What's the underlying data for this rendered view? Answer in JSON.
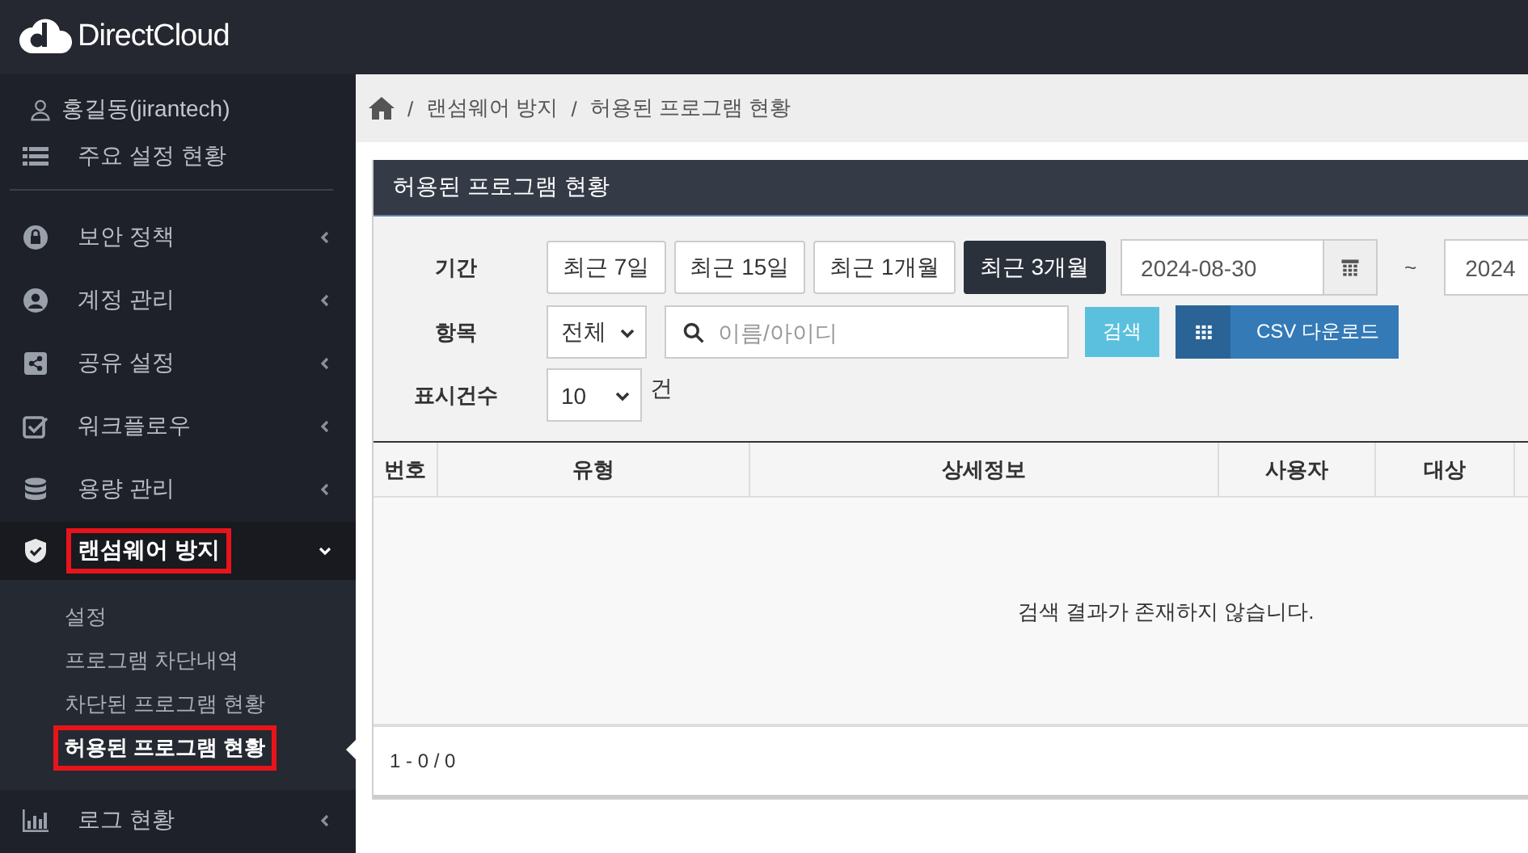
{
  "brand": "DirectCloud",
  "sidebar": {
    "user": "홍길동(jirantech)",
    "items": [
      {
        "label": "주요 설정 현황",
        "kind": "link"
      },
      {
        "label": "보안 정책",
        "kind": "menu",
        "expanded": false,
        "highlighted": false
      },
      {
        "label": "계정 관리",
        "kind": "menu",
        "expanded": false,
        "highlighted": false
      },
      {
        "label": "공유 설정",
        "kind": "menu",
        "expanded": false,
        "highlighted": false
      },
      {
        "label": "워크플로우",
        "kind": "menu",
        "expanded": false,
        "highlighted": false
      },
      {
        "label": "용량 관리",
        "kind": "menu",
        "expanded": false,
        "highlighted": false
      },
      {
        "label": "랜섬웨어 방지",
        "kind": "menu",
        "expanded": true,
        "highlighted": true,
        "children": [
          {
            "label": "설정",
            "selected": false,
            "highlighted": false
          },
          {
            "label": "프로그램 차단내역",
            "selected": false,
            "highlighted": false
          },
          {
            "label": "차단된 프로그램 현황",
            "selected": false,
            "highlighted": false
          },
          {
            "label": "허용된 프로그램 현황",
            "selected": true,
            "highlighted": true
          }
        ]
      },
      {
        "label": "로그 현황",
        "kind": "menu",
        "expanded": false,
        "highlighted": false
      }
    ]
  },
  "breadcrumb": {
    "separator": "/",
    "items": [
      "랜섬웨어 방지",
      "허용된 프로그램 현황"
    ]
  },
  "panel": {
    "title": "허용된 프로그램 현황",
    "filters": {
      "period_label": "기간",
      "periods": [
        {
          "label": "최근 7일",
          "selected": false
        },
        {
          "label": "최근 15일",
          "selected": false
        },
        {
          "label": "최근 1개월",
          "selected": false
        },
        {
          "label": "최근 3개월",
          "selected": true
        }
      ],
      "date_from": "2024-08-30",
      "range_sep": "~",
      "date_to": "2024",
      "item_label": "항목",
      "item_select": "전체",
      "search_placeholder": "이름/아이디",
      "search_button": "검색",
      "csv_button": "CSV 다운로드",
      "count_label": "표시건수",
      "count_select": "10",
      "count_unit": "건"
    },
    "table": {
      "columns": [
        "번호",
        "유형",
        "상세정보",
        "사용자",
        "대상"
      ],
      "empty_message": "검색 결과가 존재하지 않습니다.",
      "footer": "1 - 0 / 0"
    }
  }
}
